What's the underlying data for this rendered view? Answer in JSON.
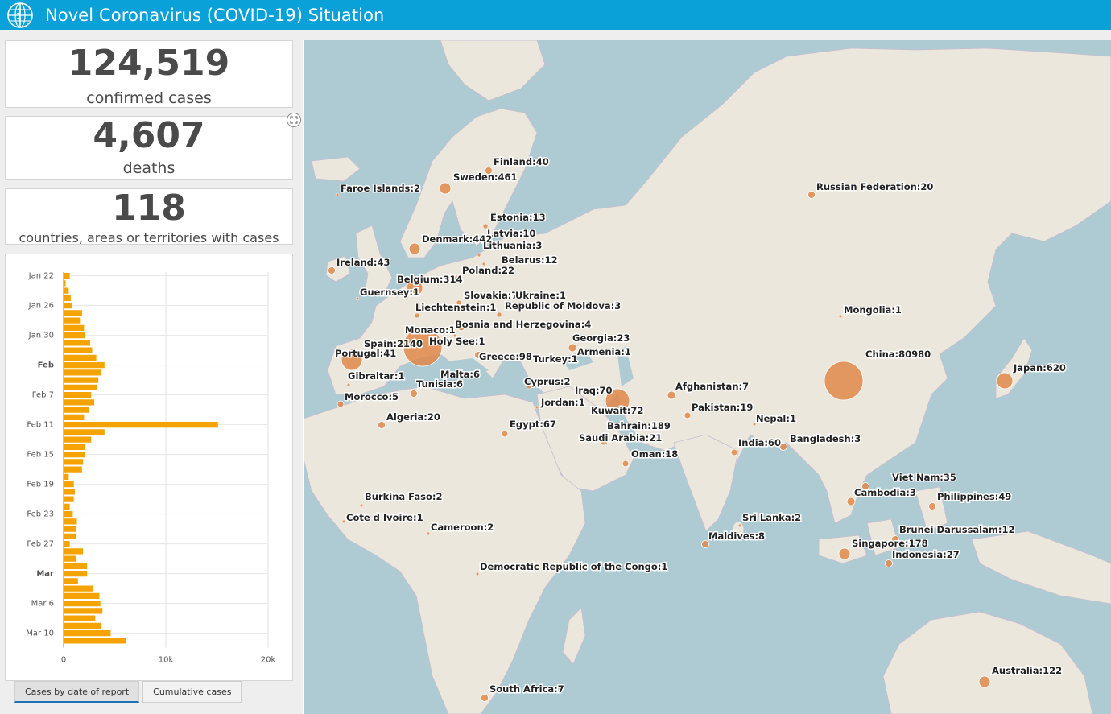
{
  "header": {
    "title": "Novel Coronavirus (COVID-19) Situation",
    "logo_icon": "who-emblem-icon",
    "bg_color": "#0aa1d9"
  },
  "stats": {
    "confirmed": {
      "value": "124,519",
      "label": "confirmed cases"
    },
    "deaths": {
      "value": "4,607",
      "label": "deaths"
    },
    "countries": {
      "value": "118",
      "label": "countries, areas or territories with cases"
    }
  },
  "tabs": {
    "by_date": "Cases by date of report",
    "cumulative": "Cumulative cases"
  },
  "chart_data": {
    "type": "bar",
    "orientation": "horizontal",
    "bar_color": "#f4a300",
    "y_tick_labels": [
      "Jan 22",
      "Jan 26",
      "Jan 30",
      "Feb",
      "Feb 7",
      "Feb 11",
      "Feb 15",
      "Feb 19",
      "Feb 23",
      "Feb 27",
      "Mar",
      "Mar 6",
      "Mar 10"
    ],
    "x_ticks": [
      "0",
      "10k",
      "20k"
    ],
    "xlim": [
      0,
      20000
    ],
    "grid": true,
    "values": [
      600,
      200,
      500,
      700,
      800,
      1800,
      1600,
      2000,
      2100,
      2600,
      2800,
      3200,
      4000,
      3700,
      3400,
      3300,
      2700,
      3000,
      2500,
      2000,
      15100,
      4000,
      2700,
      2100,
      2100,
      1900,
      1800,
      500,
      1000,
      1100,
      1000,
      600,
      900,
      1300,
      1200,
      1200,
      600,
      1900,
      1200,
      2300,
      2300,
      1400,
      2900,
      3500,
      3600,
      3800,
      3100,
      3700,
      4600,
      6100
    ]
  },
  "map": {
    "marker_color": "#e0874a",
    "labels": [
      "Finland:40",
      "Sweden:461",
      "Faroe Islands:2",
      "Russian Federation:20",
      "Estonia:13",
      "Latvia:10",
      "Denmark:442",
      "Lithuania:3",
      "Belarus:12",
      "Ireland:43",
      "Poland:22",
      "Belgium:314",
      "Guernsey:1",
      "Slovakia:7",
      "Ukraine:1",
      "Liechtenstein:1",
      "Republic of Moldova:3",
      "Mongolia:1",
      "Bosnia and Herzegovina:4",
      "Monaco:1",
      "Georgia:23",
      "Holy See:1",
      "Spain:2140",
      "Armenia:1",
      "Portugal:41",
      "Greece:98",
      "Turkey:1",
      "China:80980",
      "Japan:620",
      "Gibraltar:1",
      "Malta:6",
      "Cyprus:2",
      "Tunisia:6",
      "Afghanistan:7",
      "Iraq:70",
      "Morocco:5",
      "Jordan:1",
      "Kuwait:72",
      "Pakistan:19",
      "Algeria:20",
      "Nepal:1",
      "Bahrain:189",
      "Egypt:67",
      "Saudi Arabia:21",
      "India:60",
      "Bangladesh:3",
      "Oman:18",
      "Viet Nam:35",
      "Cambodia:3",
      "Philippines:49",
      "Burkina Faso:2",
      "Sri Lanka:2",
      "Cote d Ivoire:1",
      "Cameroon:2",
      "Maldives:8",
      "Brunei Darussalam:12",
      "Singapore:178",
      "Indonesia:27",
      "Democratic Republic of the Congo:1",
      "Australia:122",
      "South Africa:7"
    ]
  }
}
